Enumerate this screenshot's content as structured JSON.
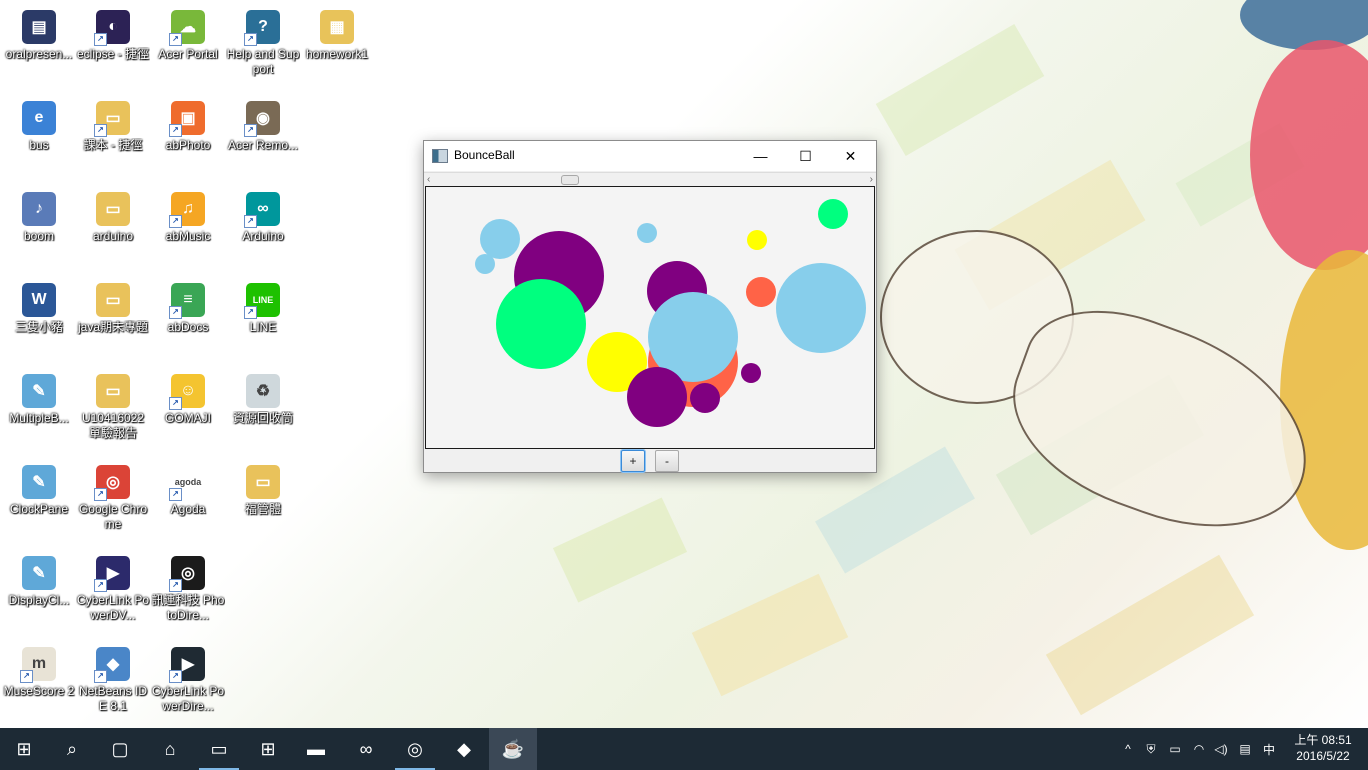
{
  "desktop": {
    "icons": [
      {
        "label": "oralpresen...",
        "icon": "video-file-icon",
        "color": "#2b3a67",
        "glyph": "▤",
        "col": 0,
        "row": 0,
        "shortcut": false
      },
      {
        "label": "eclipse - 捷徑",
        "icon": "eclipse-icon",
        "color": "#2c2255",
        "glyph": "◐",
        "col": 1,
        "row": 0,
        "shortcut": true
      },
      {
        "label": "Acer Portal",
        "icon": "acer-portal-icon",
        "color": "#79b83a",
        "glyph": "☁",
        "col": 2,
        "row": 0,
        "shortcut": true
      },
      {
        "label": "Help and Support",
        "icon": "help-icon",
        "color": "#2a6f97",
        "glyph": "?",
        "col": 3,
        "row": 0,
        "shortcut": true
      },
      {
        "label": "homework1",
        "icon": "zip-folder-icon",
        "color": "#e8c35a",
        "glyph": "▦",
        "col": 4,
        "row": 0,
        "shortcut": false
      },
      {
        "label": "bus",
        "icon": "pdf-file-icon",
        "color": "#3b82d6",
        "glyph": "e",
        "col": 0,
        "row": 1,
        "shortcut": false
      },
      {
        "label": "課本 - 捷徑",
        "icon": "folder-icon",
        "color": "#e9c25b",
        "glyph": "▭",
        "col": 1,
        "row": 1,
        "shortcut": true
      },
      {
        "label": "abPhoto",
        "icon": "abphoto-icon",
        "color": "#ef6c2d",
        "glyph": "▣",
        "col": 2,
        "row": 1,
        "shortcut": true
      },
      {
        "label": "Acer Remo...",
        "icon": "acer-remote-icon",
        "color": "#7a6a55",
        "glyph": "◉",
        "col": 3,
        "row": 1,
        "shortcut": true
      },
      {
        "label": "boom",
        "icon": "mp3-file-icon",
        "color": "#5a7bb8",
        "glyph": "♪",
        "col": 0,
        "row": 2,
        "shortcut": false
      },
      {
        "label": "arduino",
        "icon": "folder-icon",
        "color": "#e9c25b",
        "glyph": "▭",
        "col": 1,
        "row": 2,
        "shortcut": false
      },
      {
        "label": "abMusic",
        "icon": "abmusic-icon",
        "color": "#f5a623",
        "glyph": "♫",
        "col": 2,
        "row": 2,
        "shortcut": true
      },
      {
        "label": "Arduino",
        "icon": "arduino-icon",
        "color": "#00979c",
        "glyph": "∞",
        "col": 3,
        "row": 2,
        "shortcut": true
      },
      {
        "label": "三隻小豬",
        "icon": "word-doc-icon",
        "color": "#2b5797",
        "glyph": "W",
        "col": 0,
        "row": 3,
        "shortcut": false
      },
      {
        "label": "java期末專題",
        "icon": "folder-icon",
        "color": "#e9c25b",
        "glyph": "▭",
        "col": 1,
        "row": 3,
        "shortcut": false
      },
      {
        "label": "abDocs",
        "icon": "abdocs-icon",
        "color": "#3aa655",
        "glyph": "≡",
        "col": 2,
        "row": 3,
        "shortcut": true
      },
      {
        "label": "LINE",
        "icon": "line-icon",
        "color": "#1ec100",
        "glyph": "LINE",
        "col": 3,
        "row": 3,
        "shortcut": true
      },
      {
        "label": "MultipleB...",
        "icon": "notepad-icon",
        "color": "#5fa8d8",
        "glyph": "✎",
        "col": 0,
        "row": 4,
        "shortcut": false
      },
      {
        "label": "U10416022 單驗報告",
        "icon": "folder-icon",
        "color": "#e9c25b",
        "glyph": "▭",
        "col": 1,
        "row": 4,
        "shortcut": false
      },
      {
        "label": "GOMAJI",
        "icon": "gomaji-icon",
        "color": "#f4c430",
        "glyph": "☺",
        "col": 2,
        "row": 4,
        "shortcut": true
      },
      {
        "label": "資源回收筒",
        "icon": "recycle-bin-icon",
        "color": "#cfd8dc",
        "glyph": "♻",
        "col": 3,
        "row": 4,
        "shortcut": false
      },
      {
        "label": "ClockPane",
        "icon": "notepad-icon",
        "color": "#5fa8d8",
        "glyph": "✎",
        "col": 0,
        "row": 5,
        "shortcut": false
      },
      {
        "label": "Google Chrome",
        "icon": "chrome-icon",
        "color": "#db4437",
        "glyph": "◎",
        "col": 1,
        "row": 5,
        "shortcut": true
      },
      {
        "label": "Agoda",
        "icon": "agoda-icon",
        "color": "#ffffff",
        "glyph": "agoda",
        "col": 2,
        "row": 5,
        "shortcut": true
      },
      {
        "label": "福管體",
        "icon": "folder-icon",
        "color": "#e9c25b",
        "glyph": "▭",
        "col": 3,
        "row": 5,
        "shortcut": false
      },
      {
        "label": "DisplayCl...",
        "icon": "notepad-icon",
        "color": "#5fa8d8",
        "glyph": "✎",
        "col": 0,
        "row": 6,
        "shortcut": false
      },
      {
        "label": "CyberLink PowerDV...",
        "icon": "powerdvd-icon",
        "color": "#2c2a6b",
        "glyph": "▶",
        "col": 1,
        "row": 6,
        "shortcut": true
      },
      {
        "label": "訊連科技 PhotoDire...",
        "icon": "photodirector-icon",
        "color": "#1b1b1b",
        "glyph": "◎",
        "col": 2,
        "row": 6,
        "shortcut": true
      },
      {
        "label": "MuseScore 2",
        "icon": "musescore-icon",
        "color": "#e8e3d6",
        "glyph": "m",
        "col": 0,
        "row": 7,
        "shortcut": true
      },
      {
        "label": "NetBeans IDE 8.1",
        "icon": "netbeans-icon",
        "color": "#4a86c8",
        "glyph": "◆",
        "col": 1,
        "row": 7,
        "shortcut": true
      },
      {
        "label": "CyberLink PowerDire...",
        "icon": "powerdirector-icon",
        "color": "#1f2a33",
        "glyph": "▶",
        "col": 2,
        "row": 7,
        "shortcut": true
      }
    ]
  },
  "window": {
    "title": "BounceBall",
    "minimize_glyph": "—",
    "maximize_glyph": "☐",
    "close_glyph": "✕",
    "scroll_left_glyph": "‹",
    "scroll_right_glyph": "›",
    "plus_label": "+",
    "minus_label": "-",
    "balls": [
      {
        "color": "#87ceeb",
        "data": [
          74,
          52,
          20
        ]
      },
      {
        "color": "#87ceeb",
        "data": [
          59,
          77,
          10
        ]
      },
      {
        "color": "#800080",
        "data": [
          133,
          89,
          45
        ]
      },
      {
        "color": "#00ff7f",
        "data": [
          115,
          137,
          45
        ]
      },
      {
        "color": "#87ceeb",
        "data": [
          221,
          46,
          10
        ]
      },
      {
        "color": "#ffff00",
        "data": [
          331,
          53,
          10
        ]
      },
      {
        "color": "#00ff7f",
        "data": [
          407,
          27,
          15
        ]
      },
      {
        "color": "#800080",
        "data": [
          251,
          104,
          30
        ]
      },
      {
        "color": "#ff6347",
        "data": [
          335,
          105,
          15
        ]
      },
      {
        "color": "#87ceeb",
        "data": [
          395,
          121,
          45
        ]
      },
      {
        "color": "#ffff00",
        "data": [
          191,
          175,
          30
        ]
      },
      {
        "color": "#ff6347",
        "data": [
          267,
          175,
          45
        ]
      },
      {
        "color": "#87ceeb",
        "data": [
          267,
          150,
          45
        ]
      },
      {
        "color": "#800080",
        "data": [
          325,
          186,
          10
        ]
      },
      {
        "color": "#800080",
        "data": [
          231,
          210,
          30
        ]
      },
      {
        "color": "#800080",
        "data": [
          279,
          211,
          15
        ]
      }
    ]
  },
  "taskbar": {
    "items": [
      {
        "icon": "windows-start-icon",
        "glyph": "⊞",
        "state": ""
      },
      {
        "icon": "search-icon",
        "glyph": "⌕",
        "state": ""
      },
      {
        "icon": "task-view-icon",
        "glyph": "▢",
        "state": ""
      },
      {
        "icon": "edge-home-icon",
        "glyph": "⌂",
        "state": ""
      },
      {
        "icon": "file-explorer-icon",
        "glyph": "▭",
        "state": "open"
      },
      {
        "icon": "store-icon",
        "glyph": "⊞",
        "state": ""
      },
      {
        "icon": "command-prompt-icon",
        "glyph": "▬",
        "state": ""
      },
      {
        "icon": "visual-studio-icon",
        "glyph": "∞",
        "state": ""
      },
      {
        "icon": "chrome-taskbar-icon",
        "glyph": "◎",
        "state": "open"
      },
      {
        "icon": "netbeans-taskbar-icon",
        "glyph": "◆",
        "state": ""
      },
      {
        "icon": "java-taskbar-icon",
        "glyph": "☕",
        "state": "active"
      }
    ],
    "tray": [
      {
        "icon": "chevron-up-icon",
        "glyph": "^"
      },
      {
        "icon": "security-icon",
        "glyph": "⛨"
      },
      {
        "icon": "battery-icon",
        "glyph": "▭"
      },
      {
        "icon": "wifi-icon",
        "glyph": "◠"
      },
      {
        "icon": "volume-icon",
        "glyph": "◁)"
      },
      {
        "icon": "action-center-icon",
        "glyph": "▤"
      },
      {
        "icon": "input-method-icon",
        "glyph": "中"
      }
    ],
    "clock_time": "上午 08:51",
    "clock_date": "2016/5/22"
  }
}
